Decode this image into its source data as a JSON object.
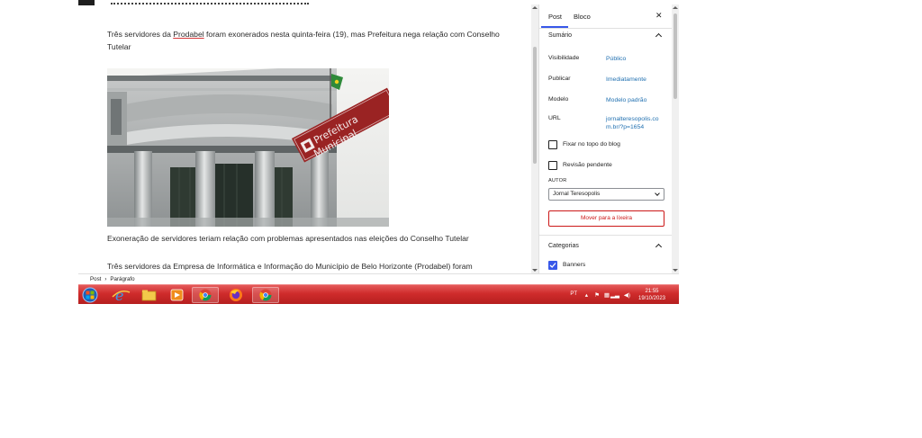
{
  "editor": {
    "paragraph_1_pre": "Três servidores da ",
    "paragraph_1_link": "Prodabel",
    "paragraph_1_post": " foram exonerados nesta quinta-feira (19), mas Prefeitura nega relação com Conselho Tutelar",
    "image_sign_text": "Prefeitura Municipal",
    "caption": "Exoneração de servidores teriam relação com problemas apresentados nas eleições do Conselho Tutelar",
    "paragraph_2": "Três servidores da Empresa de Informática e Informação do Município de Belo Horizonte (Prodabel) foram"
  },
  "sidebar": {
    "tabs": [
      "Post",
      "Bloco"
    ],
    "close_glyph": "✕",
    "summary_title": "Sumário",
    "rows": [
      {
        "label": "Visibilidade",
        "value": "Público"
      },
      {
        "label": "Publicar",
        "value": "Imediatamente"
      },
      {
        "label": "Modelo",
        "value": "Modelo padrão"
      },
      {
        "label": "URL",
        "value": "jornalteresopolis.com.br/?p=1654"
      }
    ],
    "checkboxes": [
      {
        "label": "Fixar no topo do blog",
        "checked": false
      },
      {
        "label": "Revisão pendente",
        "checked": false
      }
    ],
    "author_label": "AUTOR",
    "author_value": "Jornal Teresopolis",
    "trash_button": "Mover para a lixeira",
    "categories_title": "Categorias",
    "category_items": [
      {
        "label": "Banners",
        "checked": true
      }
    ]
  },
  "breadcrumb": {
    "items": [
      "Post",
      "Parágrafo"
    ]
  },
  "taskbar": {
    "language": "PT",
    "time": "21:55",
    "date": "19/10/2023",
    "apps": [
      "start-button",
      "internet-explorer",
      "file-explorer",
      "media-player",
      "chrome",
      "firefox",
      "chrome-active"
    ]
  },
  "colors": {
    "accent": "#3858e9",
    "link": "#2271b1",
    "danger": "#cc1818",
    "taskbar": "#cf2b2b"
  }
}
